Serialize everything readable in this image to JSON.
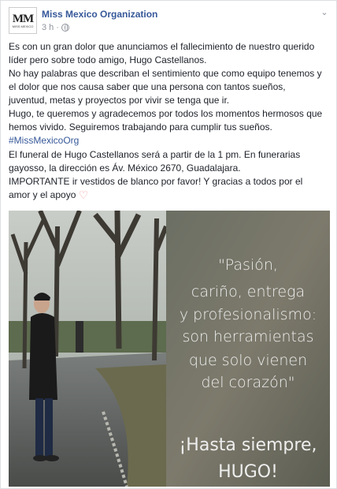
{
  "post": {
    "page_name": "Miss Mexico Organization",
    "avatar_text": "MM",
    "avatar_subtext": "MISS MEXICO",
    "timestamp": "3 h",
    "separator": "·",
    "paragraph1": [
      "Es con un gran dolor que anunciamos el fallecimiento de nuestro querido",
      "líder pero sobre todo amigo, Hugo Castellanos.",
      "No hay palabras que describan el sentimiento que como equipo tenemos y",
      "el dolor que nos causa saber que una persona con tantos sueños,",
      "juventud, metas y proyectos por vivir se tenga que ir.",
      "Hugo, te queremos y agradecemos por todos los momentos hermosos que",
      "hemos vivido. Seguiremos trabajando para cumplir tus sueños."
    ],
    "hashtag": "#MissMexicoOrg",
    "paragraph2": [
      "El funeral de Hugo Castellanos será a partir de la 1 pm. En funerarias",
      "gayosso, la dirección es Áv. México 2670, Guadalajara.",
      "IMPORTANTE ir vestidos de blanco por favor! Y gracias a todos por el",
      "amor y el apoyo"
    ],
    "emoji": "heart-emoji",
    "photo": {
      "quote_lines": [
        "\"Pasión,",
        "cariño, entrega",
        "y profesionalismo:",
        "son herramientas",
        "que solo vienen",
        "del corazón\""
      ],
      "farewell_lines": [
        "¡Hasta siempre,",
        "HUGO!"
      ]
    }
  },
  "colors": {
    "link": "#365899",
    "meta": "#90949c",
    "text": "#1d2129",
    "heart": "#f7a4a4",
    "quote_text": "#eeeeee"
  }
}
